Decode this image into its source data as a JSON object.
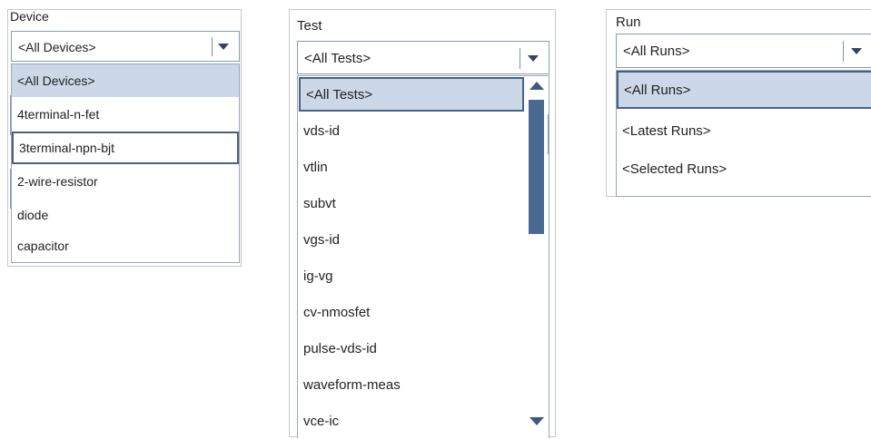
{
  "device": {
    "title": "Device",
    "selected_value": "<All Devices>",
    "options": [
      "<All Devices>",
      "4terminal-n-fet",
      "3terminal-npn-bjt",
      "2-wire-resistor",
      "diode",
      "capacitor"
    ]
  },
  "test": {
    "title": "Test",
    "selected_value": "<All Tests>",
    "options": [
      "<All Tests>",
      "vds-id",
      "vtlin",
      "subvt",
      "vgs-id",
      "ig-vg",
      "cv-nmosfet",
      "pulse-vds-id",
      "waveform-meas",
      "vce-ic"
    ]
  },
  "run": {
    "title": "Run",
    "selected_value": "<All Runs>",
    "options": [
      "<All Runs>",
      "<Latest Runs>",
      "<Selected Runs>"
    ]
  },
  "colors": {
    "highlight": "#ccd7e8",
    "focus_border": "#4a6186",
    "scroll_thumb": "#4b6a91"
  }
}
